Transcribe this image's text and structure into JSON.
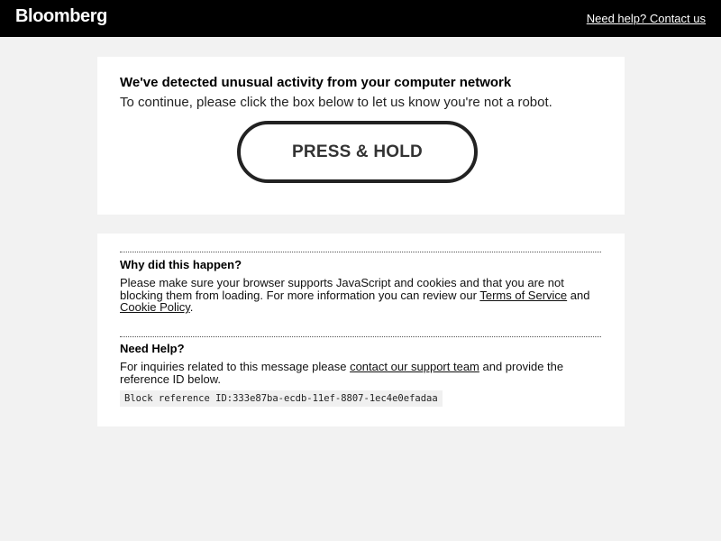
{
  "header": {
    "logo_text": "Bloomberg",
    "help_link": "Need help? Contact us"
  },
  "challenge": {
    "headline": "We've detected unusual activity from your computer network",
    "instruction": "To continue, please click the box below to let us know you're not a robot.",
    "button_label": "PRESS & HOLD"
  },
  "why": {
    "title": "Why did this happen?",
    "text_before": "Please make sure your browser supports JavaScript and cookies and that you are not blocking them from loading. For more information you can review our ",
    "terms_link": "Terms of Service",
    "text_middle": " and ",
    "cookie_link": "Cookie Policy",
    "text_after": "."
  },
  "help": {
    "title": "Need Help?",
    "text_before": "For inquiries related to this message please ",
    "support_link": "contact our support team",
    "text_after": " and provide the reference ID below.",
    "reference": "Block reference ID:333e87ba-ecdb-11ef-8807-1ec4e0efadaa"
  },
  "colors": {
    "header_bg": "#000000",
    "page_bg": "#f2f2f2",
    "card_bg": "#ffffff",
    "button_border": "#222222"
  }
}
